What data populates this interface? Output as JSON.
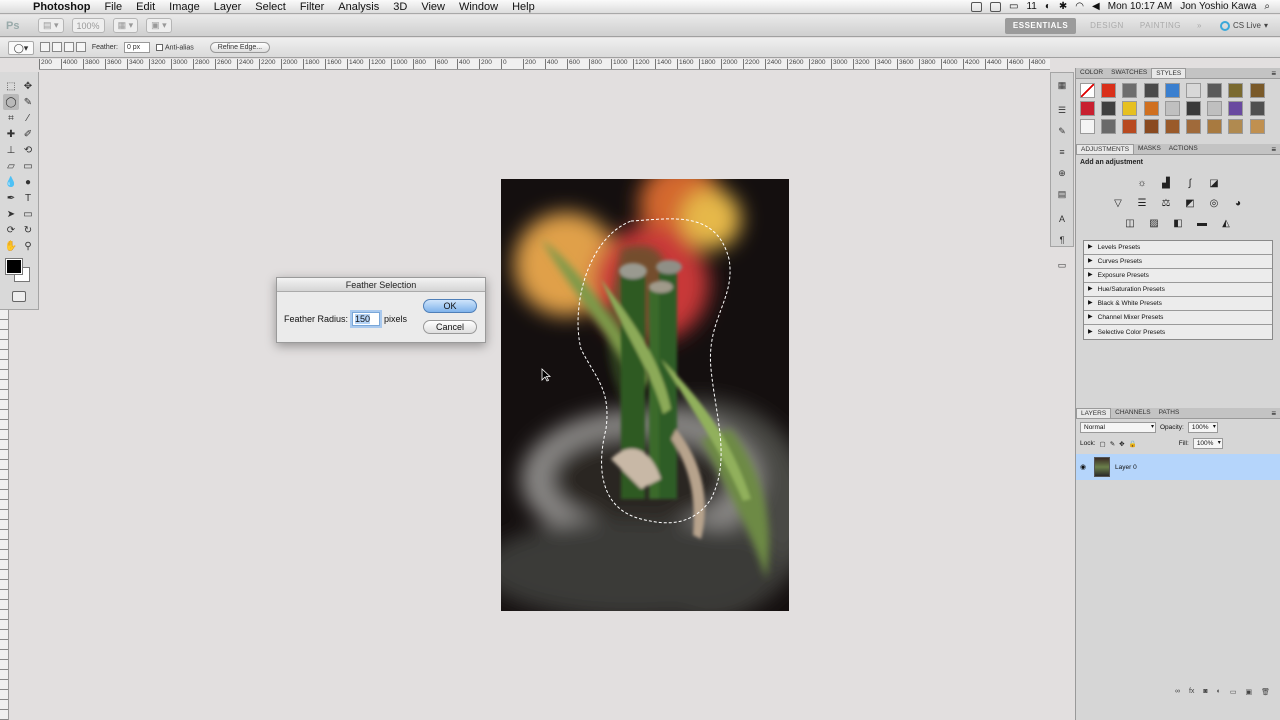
{
  "menubar": {
    "app": "Photoshop",
    "items": [
      "File",
      "Edit",
      "Image",
      "Layer",
      "Select",
      "Filter",
      "Analysis",
      "3D",
      "View",
      "Window",
      "Help"
    ],
    "battery": "11",
    "clock": "Mon 10:17 AM",
    "user": "Jon Yoshio Kawa"
  },
  "appbar": {
    "logo": "Ps",
    "zoom": "100%",
    "workspaces": [
      "ESSENTIALS",
      "DESIGN",
      "PAINTING"
    ],
    "more": "»",
    "cslive": "CS Live"
  },
  "options": {
    "feather_label": "Feather:",
    "feather_value": "0 px",
    "antialias_label": "Anti-alias",
    "refine_edge": "Refine Edge..."
  },
  "ruler": {
    "labels": [
      "200",
      "4000",
      "3800",
      "3600",
      "3400",
      "3200",
      "3000",
      "2800",
      "2600",
      "2400",
      "2200",
      "2000",
      "1800",
      "1600",
      "1400",
      "1200",
      "1000",
      "800",
      "600",
      "400",
      "200",
      "0",
      "200",
      "400",
      "600",
      "800",
      "1000",
      "1200",
      "1400",
      "1600",
      "1800",
      "2000",
      "2200",
      "2400",
      "2600",
      "2800",
      "3000",
      "3200",
      "3400",
      "3600",
      "3800",
      "4000",
      "4200",
      "4400",
      "4600",
      "4800"
    ]
  },
  "dialog": {
    "title": "Feather Selection",
    "field_label": "Feather Radius:",
    "field_value": "150",
    "unit": "pixels",
    "ok": "OK",
    "cancel": "Cancel"
  },
  "panels": {
    "top_tabs": [
      "COLOR",
      "SWATCHES",
      "STYLES"
    ],
    "style_colors": [
      "#ffffff",
      "#d9301a",
      "#6d6d6d",
      "#4a4a4a",
      "#3a7fcf",
      "#d8d8d8",
      "#5a5a5a",
      "#7a6a30",
      "#7a5a2a",
      "#c82030",
      "#404040",
      "#e6c020",
      "#d07020",
      "#c0c0c0",
      "#3a3a3a",
      "#bfbfbf",
      "#6a4aa0",
      "#505050",
      "#f4f4f4",
      "#6a6a6a",
      "#b84a20",
      "#8a4a20",
      "#9a5a2a",
      "#a06a3a",
      "#a87a40",
      "#b08a50",
      "#c09050"
    ],
    "adj_tabs": [
      "ADJUSTMENTS",
      "MASKS",
      "ACTIONS"
    ],
    "adj_title": "Add an adjustment",
    "presets": [
      "Levels Presets",
      "Curves Presets",
      "Exposure Presets",
      "Hue/Saturation Presets",
      "Black & White Presets",
      "Channel Mixer Presets",
      "Selective Color Presets"
    ],
    "layer_tabs": [
      "LAYERS",
      "CHANNELS",
      "PATHS"
    ],
    "blend_mode": "Normal",
    "opacity_label": "Opacity:",
    "opacity_value": "100%",
    "lock_label": "Lock:",
    "fill_label": "Fill:",
    "fill_value": "100%",
    "layer_name": "Layer 0"
  }
}
